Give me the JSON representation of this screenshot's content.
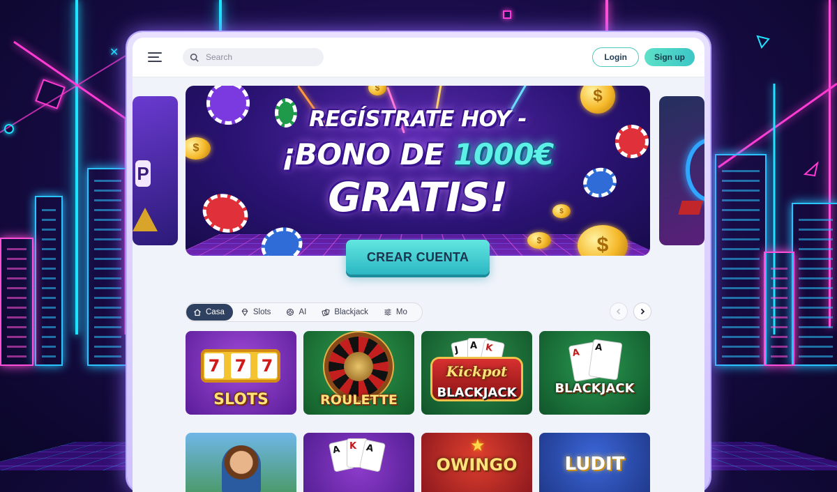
{
  "topbar": {
    "search_placeholder": "Search",
    "login_label": "Login",
    "signup_label": "Sign up"
  },
  "hero": {
    "line1": "REGÍSTRATE HOY -",
    "line2_prefix": "¡BONO DE ",
    "line2_amount": "1000€",
    "line3": "GRATIS!",
    "cta_label": "CREAR CUENTA",
    "side_left_glyph": "P"
  },
  "categories": [
    {
      "label": "Casa",
      "icon": "home-icon",
      "active": true
    },
    {
      "label": "Slots",
      "icon": "gem-icon",
      "active": false
    },
    {
      "label": "AI",
      "icon": "roulette-icon",
      "active": false
    },
    {
      "label": "Blackjack",
      "icon": "cards-icon",
      "active": false
    },
    {
      "label": "Mo",
      "icon": "sliders-icon",
      "active": false
    }
  ],
  "games_row1": [
    {
      "title": "SLOTS",
      "reel_symbols": [
        "7",
        "7",
        "7"
      ]
    },
    {
      "title": "ROULETTE"
    },
    {
      "title_script": "Kickpot",
      "title": "BLACKJACK",
      "cards": [
        "J",
        "A",
        "K"
      ]
    },
    {
      "title": "BLACKJACK",
      "cards": [
        "A",
        "A"
      ]
    }
  ],
  "games_row2": [
    {
      "title": ""
    },
    {
      "title": "",
      "cards": [
        "A",
        "K",
        "A"
      ]
    },
    {
      "title": "OWINGO"
    },
    {
      "title": "LUDIT"
    }
  ],
  "colors": {
    "accent_teal": "#4cc7bd",
    "active_category": "#2f4160",
    "neon_pink": "#ff3bd4",
    "neon_cyan": "#1fe3ff"
  }
}
